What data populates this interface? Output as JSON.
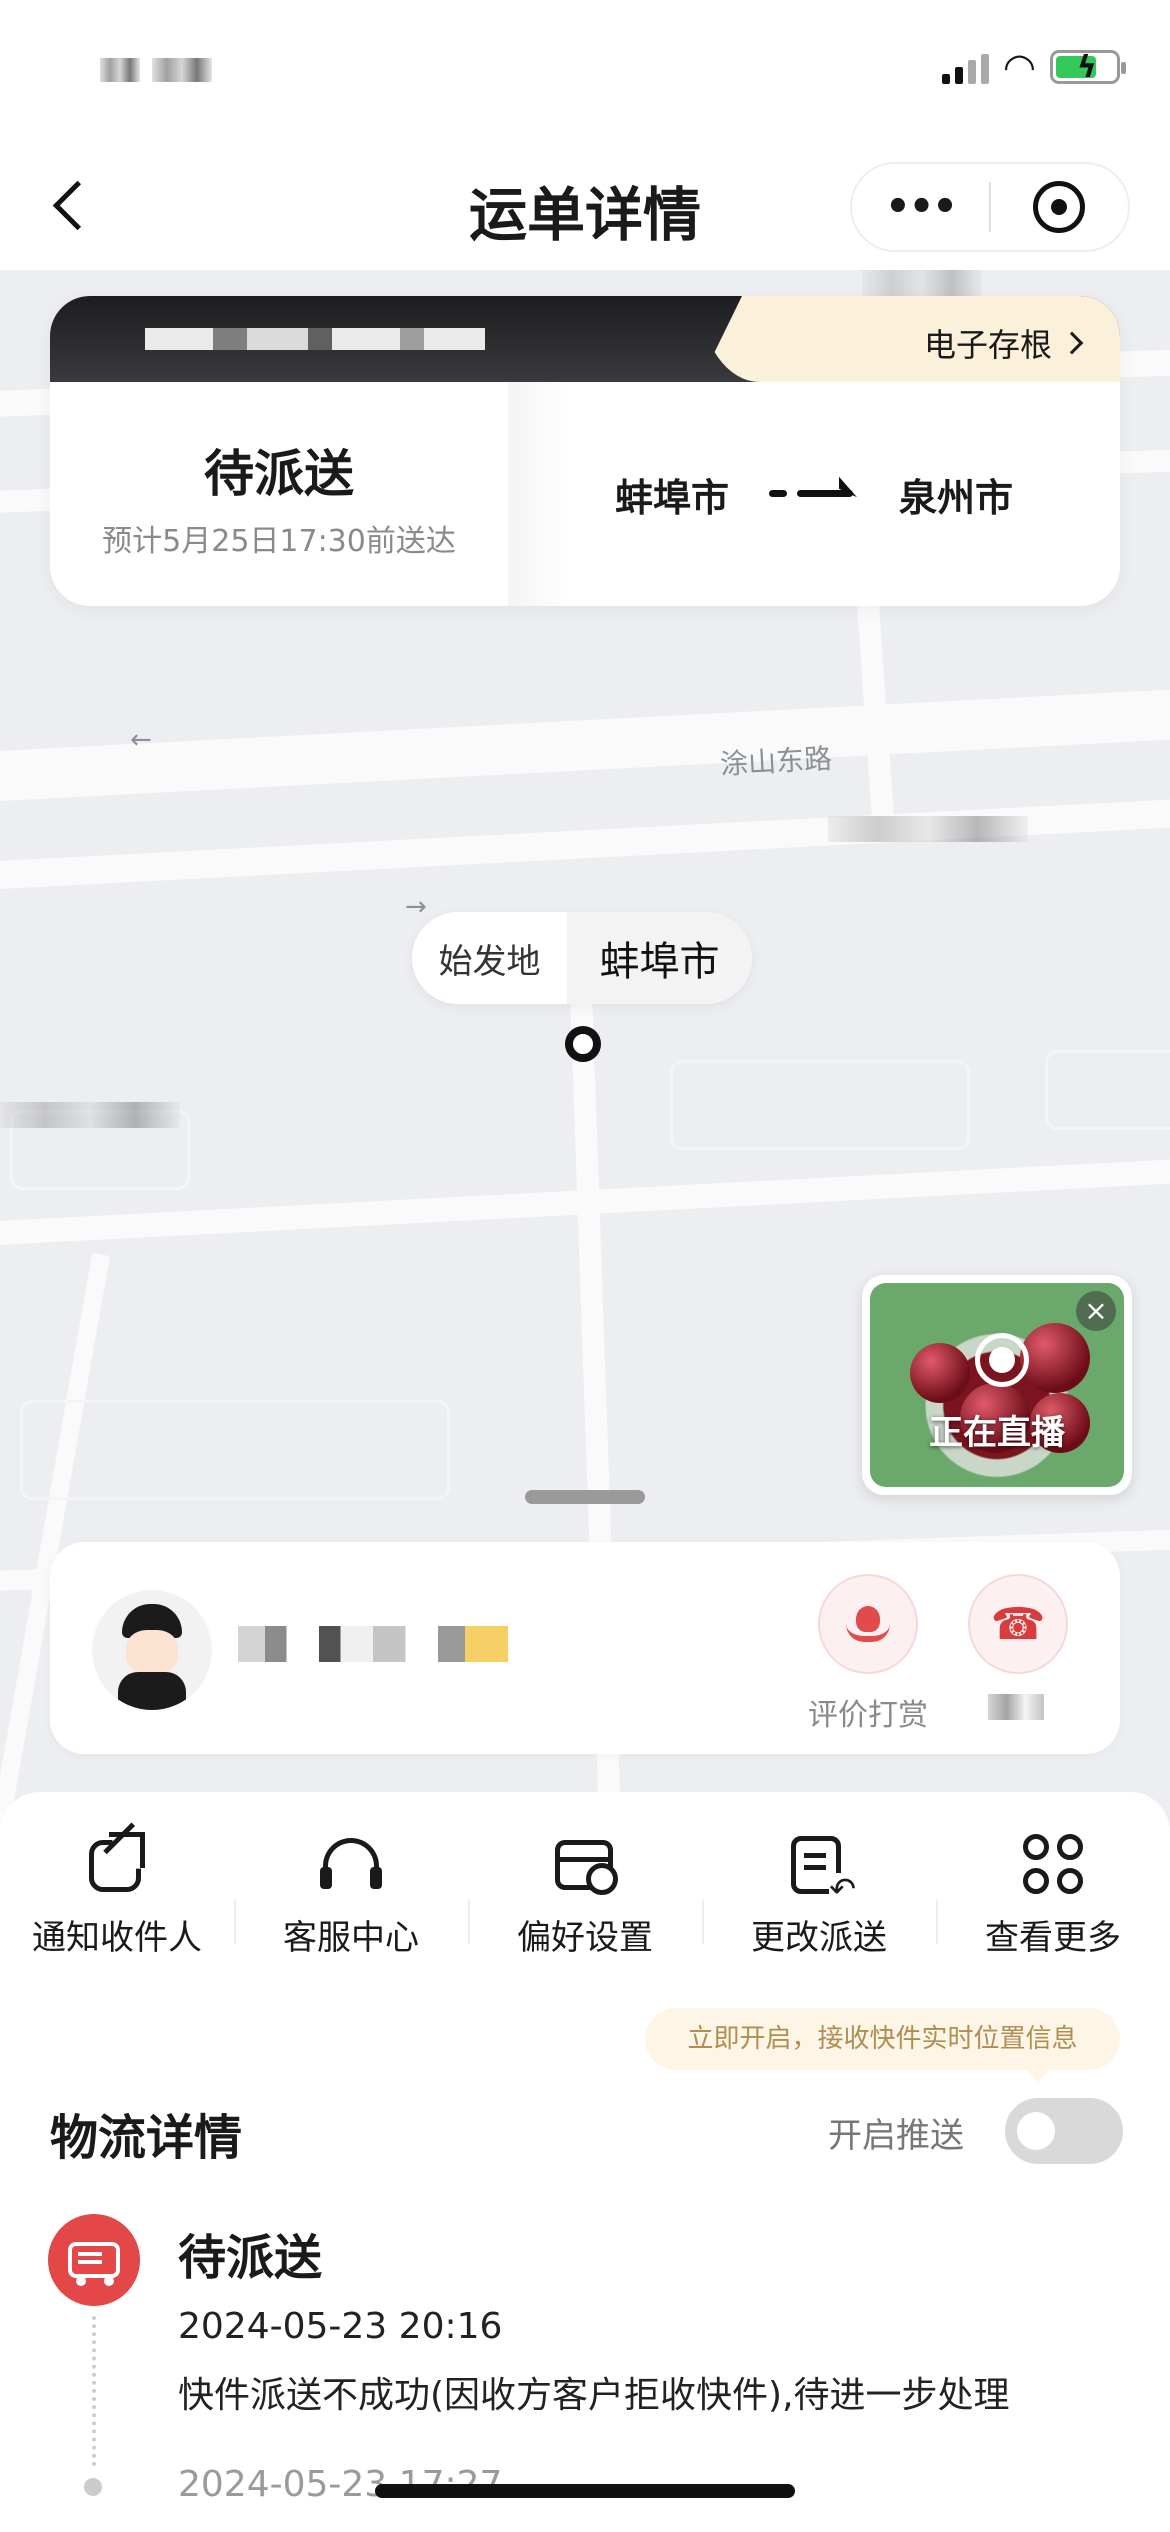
{
  "nav": {
    "title": "运单详情",
    "more_label": "•••"
  },
  "waybill": {
    "stub_link": "电子存根",
    "status": "待派送",
    "eta": "预计5月25日17:30前送达",
    "from_city": "蚌埠市",
    "to_city": "泉州市"
  },
  "map": {
    "road_label": "涂山东路",
    "origin_label": "始发地",
    "origin_city": "蚌埠市"
  },
  "live": {
    "text": "正在直播",
    "close": "×"
  },
  "courier": {
    "rate_label": "评价打赏",
    "call_icon": "☎"
  },
  "actions": [
    {
      "label": "通知收件人",
      "icon": "share-icon"
    },
    {
      "label": "客服中心",
      "icon": "headset-icon"
    },
    {
      "label": "偏好设置",
      "icon": "preference-card-icon"
    },
    {
      "label": "更改派送",
      "icon": "change-delivery-icon"
    },
    {
      "label": "查看更多",
      "icon": "grid-more-icon"
    }
  ],
  "logistics": {
    "push_tip": "立即开启，接收快件实时位置信息",
    "title": "物流详情",
    "push_label": "开启推送",
    "push_enabled": false,
    "events": [
      {
        "status": "待派送",
        "time": "2024-05-23 20:16",
        "desc": "快件派送不成功(因收方客户拒收快件),待进一步处理"
      },
      {
        "time": "2024-05-23 17:27"
      }
    ]
  },
  "colors": {
    "accent_red": "#e34747",
    "cream": "#fbf0d9",
    "tip_text": "#b08d52"
  }
}
